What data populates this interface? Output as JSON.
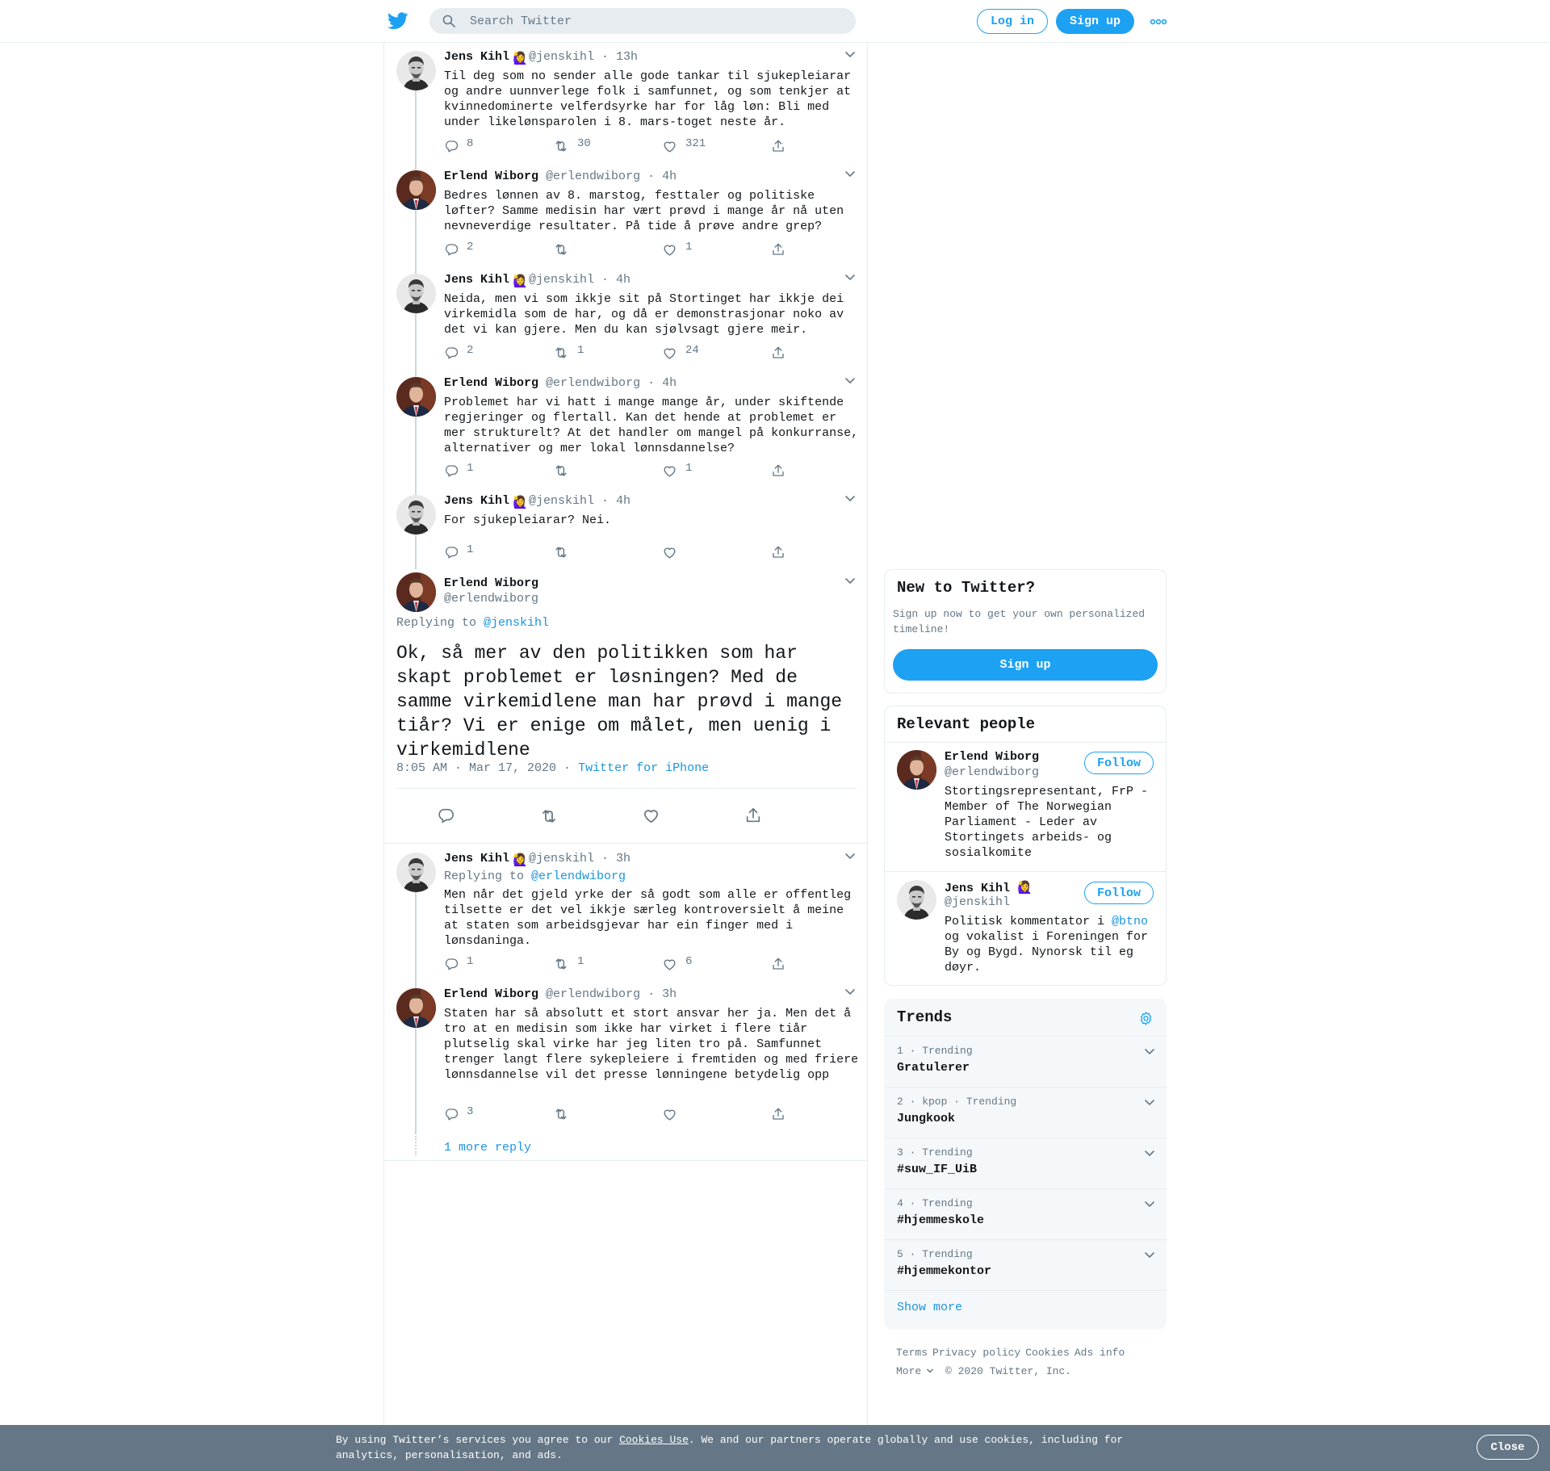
{
  "topbar": {
    "search_placeholder": "Search Twitter",
    "login_label": "Log in",
    "signup_label": "Sign up",
    "more_icon": "more-dots-icon"
  },
  "colors": {
    "accent": "#1da1f2",
    "text": "#14171a",
    "muted": "#657786",
    "border": "#e6ecf0",
    "cookie_bar": "#657786"
  },
  "tweets": [
    {
      "name": "Jens Kihl",
      "emoji": "🙋‍♀️",
      "handle": "@jenskihl",
      "time": "· 13h",
      "text": "Til deg som no sender alle gode tankar til sjukepleiarar og andre uunnverlege folk i samfunnet, og som tenkjer at kvinnedominerte velferdsyrke har for låg løn: Bli med under likelønsparolen i 8. mars-toget neste år.",
      "replies": "8",
      "retweets": "30",
      "likes": "321"
    },
    {
      "name": "Erlend Wiborg",
      "handle": "@erlendwiborg",
      "time": "· 4h",
      "text": "Bedres lønnen av 8. marstog, festtaler og politiske løfter? Samme medisin har vært prøvd i mange år nå uten nevneverdige resultater. På tide å prøve andre grep?",
      "replies": "2",
      "retweets": "",
      "likes": "1"
    },
    {
      "name": "Jens Kihl",
      "emoji": "🙋‍♀️",
      "handle": "@jenskihl",
      "time": "· 4h",
      "text": "Neida, men vi som ikkje sit på Stortinget har ikkje dei virkemidla som de har, og då er demonstrasjonar noko av det vi kan gjere. Men du kan sjølvsagt gjere meir.",
      "replies": "2",
      "retweets": "1",
      "likes": "24"
    },
    {
      "name": "Erlend Wiborg",
      "handle": "@erlendwiborg",
      "time": "· 4h",
      "text": "Problemet har vi hatt i mange mange år, under skiftende regjeringer og flertall. Kan det hende at problemet er mer strukturelt? At det handler om mangel på konkurranse, alternativer og mer lokal lønnsdannelse?",
      "replies": "1",
      "retweets": "",
      "likes": "1"
    },
    {
      "name": "Jens Kihl",
      "emoji": "🙋‍♀️",
      "handle": "@jenskihl",
      "time": "· 4h",
      "text": "For sjukepleiarar? Nei.",
      "replies": "1",
      "retweets": "",
      "likes": ""
    }
  ],
  "main_tweet": {
    "name": "Erlend Wiborg",
    "handle": "@erlendwiborg",
    "replying_prefix": "Replying to ",
    "replying_handle": "@jenskihl",
    "text": "Ok, så mer av den politikken som har skapt problemet er løsningen? Med de samme virkemidlene man har prøvd i mange tiår? Vi er enige om målet, men uenig i virkemidlene",
    "timestamp": "8:05 AM · Mar 17, 2020",
    "dot": " · ",
    "source": "Twitter for iPhone"
  },
  "replies": [
    {
      "name": "Jens Kihl",
      "emoji": "🙋‍♀️",
      "handle": "@jenskihl",
      "time": "· 3h",
      "replying_prefix": "Replying to ",
      "replying_handle": "@erlendwiborg",
      "text": "Men når det gjeld yrke der så godt som alle er offentleg tilsette er det vel ikkje særleg kontroversielt å meine at staten som arbeidsgjevar har ein finger med i lønsdaninga.",
      "replies": "1",
      "retweets": "1",
      "likes": "6"
    },
    {
      "name": "Erlend Wiborg",
      "handle": "@erlendwiborg",
      "time": "· 3h",
      "text": "Staten har så absolutt et stort ansvar her ja. Men det å tro at en medisin som ikke har virket i flere tiår plutselig skal virke har jeg liten tro på. Samfunnet trenger langt flere sykepleiere i fremtiden og med friere lønnsdannelse vil det presse lønningene betydelig opp",
      "replies": "3",
      "retweets": "",
      "likes": ""
    }
  ],
  "more_replies_label": "1 more reply",
  "sidebar": {
    "new_to_twitter": {
      "title": "New to Twitter?",
      "subtitle": "Sign up now to get your own personalized timeline!",
      "button": "Sign up"
    },
    "relevant_people": {
      "title": "Relevant people",
      "people": [
        {
          "name": "Erlend Wiborg",
          "handle": "@erlendwiborg",
          "follow": "Follow",
          "bio": "Stortingsrepresentant, FrP - Member of The Norwegian Parliament - Leder av Stortingets arbeids- og sosialkomite"
        },
        {
          "name": "Jens Kihl",
          "emoji": "🙋‍♀️",
          "handle": "@jenskihl",
          "follow": "Follow",
          "bio_prefix": "Politisk kommentator i ",
          "bio_link": "@btno",
          "bio_suffix": " og vokalist i Foreningen for By og Bygd. Nynorsk til eg døyr."
        }
      ]
    },
    "trends": {
      "title": "Trends",
      "items": [
        {
          "meta": "1 · Trending",
          "name": "Gratulerer"
        },
        {
          "meta": "2 · kpop · Trending",
          "name": "Jungkook"
        },
        {
          "meta": "3 · Trending",
          "name": "#suw_IF_UiB"
        },
        {
          "meta": "4 · Trending",
          "name": "#hjemmeskole"
        },
        {
          "meta": "5 · Trending",
          "name": "#hjemmekontor"
        }
      ],
      "show_more": "Show more"
    },
    "footer": {
      "links": [
        "Terms",
        "Privacy policy",
        "Cookies",
        "Ads info"
      ],
      "more": "More",
      "copyright": "© 2020 Twitter, Inc."
    }
  },
  "cookie_bar": {
    "prefix": "By using Twitter’s services you agree to our ",
    "link": "Cookies Use",
    "suffix": ". We and our partners operate globally and use cookies, including for analytics, personalisation, and ads.",
    "close": "Close"
  }
}
